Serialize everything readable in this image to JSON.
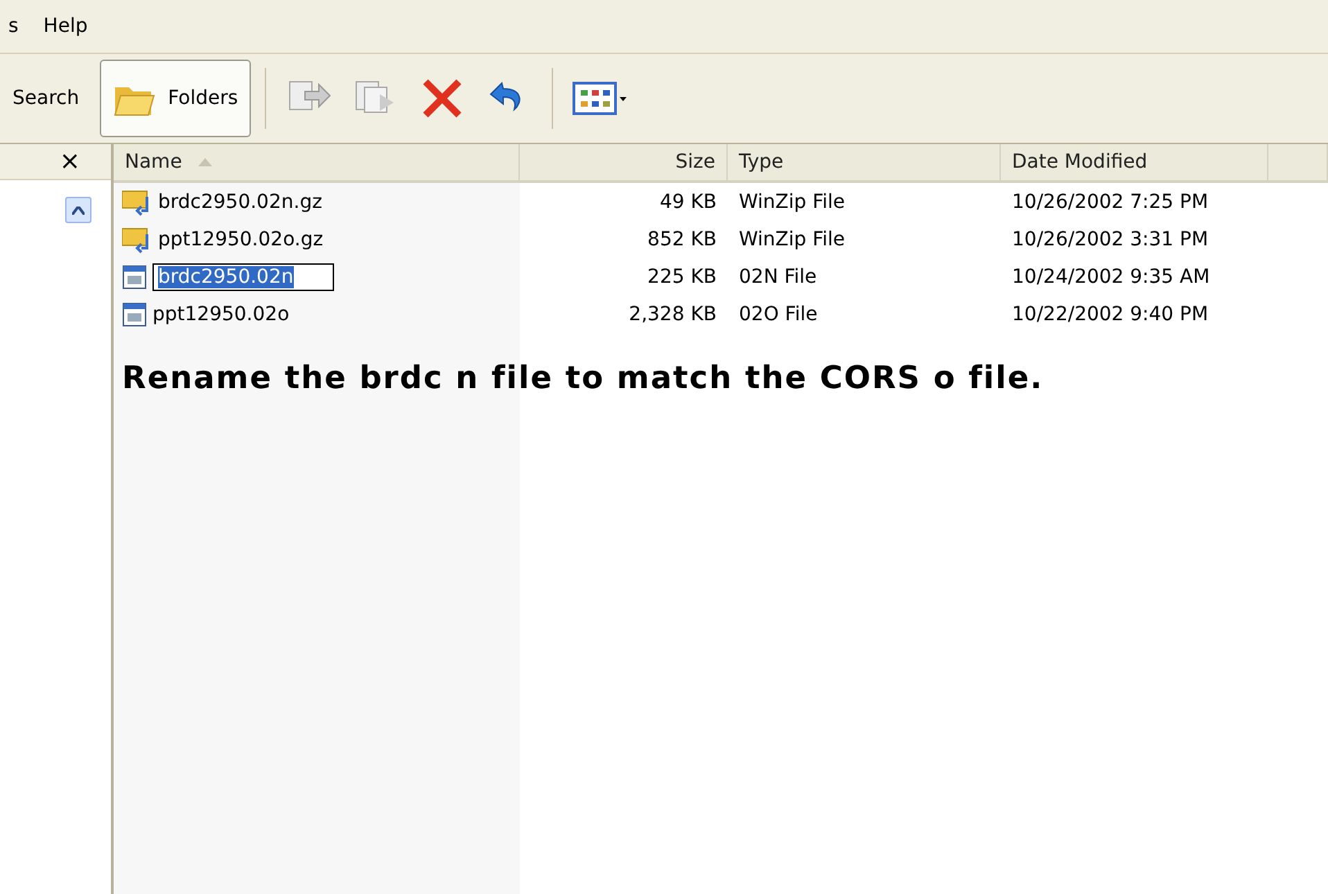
{
  "menu_bar": {
    "items": [
      "s",
      "Help"
    ]
  },
  "toolbar": {
    "buttons": [
      {
        "label": "Search",
        "selected": false
      },
      {
        "label": "Folders",
        "selected": true
      }
    ]
  },
  "left_pane": {
    "close": "×"
  },
  "file_list": {
    "columns": [
      {
        "label": "Name",
        "sorted": true
      },
      {
        "label": "Size",
        "sorted": false
      },
      {
        "label": "Type",
        "sorted": false
      },
      {
        "label": "Date Modified",
        "sorted": false
      }
    ],
    "rows": [
      {
        "kind": "zip",
        "name": "brdc2950.02n.gz",
        "size": "49 KB",
        "type": "WinZip File",
        "date": "10/26/2002 7:25 PM",
        "selected": false
      },
      {
        "kind": "zip",
        "name": "ppt12950.02o.gz",
        "size": "852 KB",
        "type": "WinZip File",
        "date": "10/26/2002 3:31 PM",
        "selected": false
      },
      {
        "kind": "file",
        "name": "brdc2950.02n",
        "size": "225 KB",
        "type": "02N File",
        "date": "10/24/2002 9:35 AM",
        "selected": true
      },
      {
        "kind": "file",
        "name": "ppt12950.02o",
        "size": "2,328 KB",
        "type": "02O File",
        "date": "10/22/2002 9:40 PM",
        "selected": false
      }
    ]
  },
  "annotation": "Rename the brdc n file to match the CORS o file."
}
